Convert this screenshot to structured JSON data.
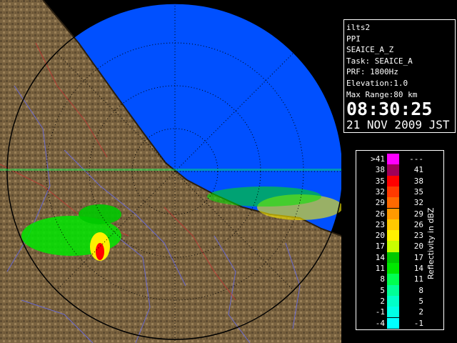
{
  "info": {
    "station": "ilts2",
    "scan_type": "PPI",
    "product": "SEAICE_A_Z",
    "task": "Task: SEAICE_A",
    "prf": "PRF: 1800Hz",
    "elevation": "Elevation:1.0",
    "max_range": "Max Range:80 km",
    "time": "08:30:25",
    "date": "21 NOV 2009 JST"
  },
  "legend": {
    "title": "Reflectivity in dBZ",
    "rows": [
      {
        "left": ">41",
        "right": "---",
        "color": "#ff00ff"
      },
      {
        "left": "38",
        "right": "41",
        "color": "#a0005a"
      },
      {
        "left": "35",
        "right": "38",
        "color": "#ff0000"
      },
      {
        "left": "32",
        "right": "35",
        "color": "#ff3a00"
      },
      {
        "left": "29",
        "right": "32",
        "color": "#ff6a00"
      },
      {
        "left": "26",
        "right": "29",
        "color": "#ff9a00"
      },
      {
        "left": "23",
        "right": "26",
        "color": "#ffc800"
      },
      {
        "left": "20",
        "right": "23",
        "color": "#fff000"
      },
      {
        "left": "17",
        "right": "20",
        "color": "#c8ff00"
      },
      {
        "left": "14",
        "right": "17",
        "color": "#00c800"
      },
      {
        "left": "11",
        "right": "14",
        "color": "#00e600"
      },
      {
        "left": "8",
        "right": "11",
        "color": "#00ff50"
      },
      {
        "left": "5",
        "right": "8",
        "color": "#00ff96"
      },
      {
        "left": "2",
        "right": "5",
        "color": "#00ffc8"
      },
      {
        "left": "-1",
        "right": "2",
        "color": "#00ffe6"
      },
      {
        "left": "-4",
        "right": "-1",
        "color": "#00ffff"
      }
    ]
  },
  "colors": {
    "sea_echo": "#0050ff",
    "land": "#7a6340",
    "background": "#000000"
  }
}
